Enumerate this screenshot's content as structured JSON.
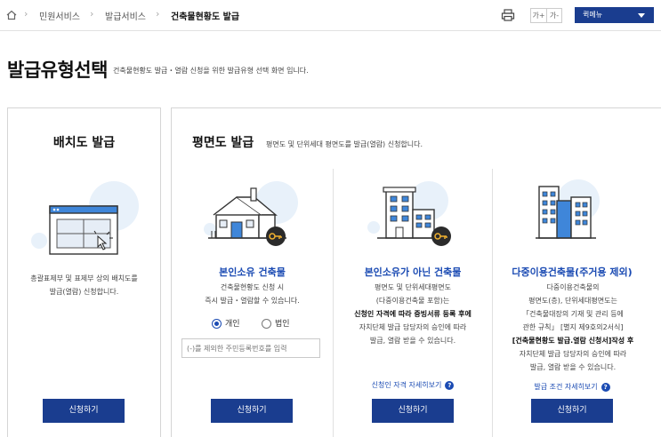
{
  "breadcrumb": {
    "items": [
      "민원서비스",
      "발급서비스",
      "건축물현황도 발급"
    ]
  },
  "toolbar": {
    "font_increase": "가+",
    "font_decrease": "가-",
    "quick_menu": "퀵메뉴"
  },
  "header": {
    "title": "발급유형선택",
    "subtitle": "건축물현황도 발급・열람 신청을 위한 발급유형 선택 화면 입니다."
  },
  "layout_card": {
    "title": "배치도 발급",
    "desc_lines": [
      "총괄표제부 및 표제부 상의 배치도를",
      "발급(열람) 신청합니다."
    ],
    "button": "신청하기"
  },
  "floorplan": {
    "title": "평면도 발급",
    "subtitle": "평면도 및 단위세대 평면도를 발급(열람) 신청합니다.",
    "cards": [
      {
        "title": "본인소유 건축물",
        "desc_lines": [
          "건축물현황도 신청 시",
          "즉시 발급・열람할 수 있습니다."
        ],
        "radio_individual": "개인",
        "radio_corporate": "법인",
        "input_placeholder": "(-)를 제외한 주민등록번호를 입력",
        "button": "신청하기"
      },
      {
        "title": "본인소유가 아닌 건축물",
        "desc_lines": [
          "평면도 및 단위세대평면도",
          "(다중이용건축물 포함)는",
          "신청인 자격에 따라 증빙서류 등록 후에",
          "자치단체 발급 담당자의 승인에 따라",
          "발급, 열람 받을 수 있습니다."
        ],
        "link": "신청인 자격 자세히보기",
        "button": "신청하기"
      },
      {
        "title": "다중이용건축물(주거용 제외)",
        "desc_lines": [
          "다중이용건축물의",
          "평면도(층), 단위세대평면도는",
          "「건축물대장의 기재 및 관리 등에",
          "관한 규칙」 [별지 제9호의2서식]",
          "[건축물현황도 발급.열람 신청서]작성 후",
          "자치단체 발급 담당자의 승인에 따라",
          "발급, 열람 받을 수 있습니다."
        ],
        "link": "발급 조건 자세히보기",
        "button": "신청하기"
      }
    ]
  },
  "help_icon": "?",
  "colors": {
    "primary": "#1a3d8f",
    "accent_text": "#1b4bb3",
    "bubble": "#e8f1fa",
    "key_badge": "#2b2b2b",
    "key_color": "#f2b230"
  }
}
